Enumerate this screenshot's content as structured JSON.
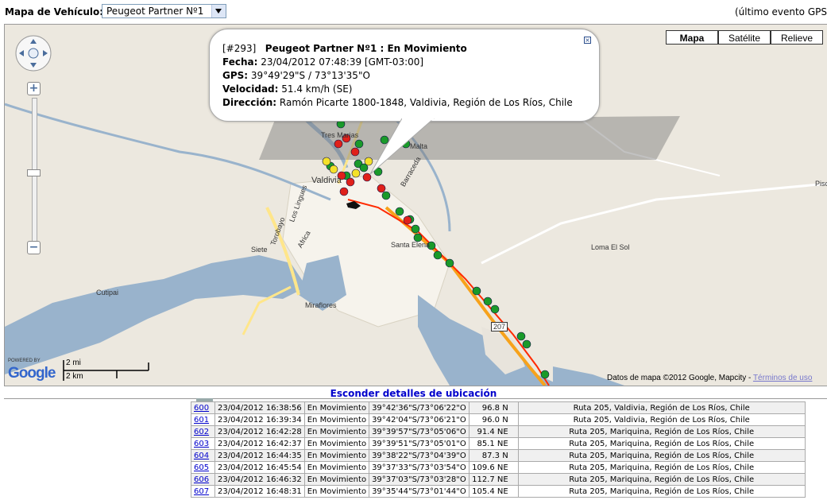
{
  "vehicle_selector": {
    "label": "Mapa de Vehículo:",
    "selected": "Peugeot Partner Nº1"
  },
  "last_event": "(último evento GPS",
  "map_types": [
    {
      "label": "Mapa",
      "active": true
    },
    {
      "label": "Satélite",
      "active": false
    },
    {
      "label": "Relieve",
      "active": false
    }
  ],
  "map_labels": {
    "valdivia": "Valdivia",
    "trumao": "Tres Marias",
    "malta": "Malta",
    "torobayo": "Torobayo",
    "los_lingues": "Los Lingues",
    "africa": "Africa",
    "siete": "Siete",
    "santa_elena": "Santa Elena",
    "cutipai": "Cutipai",
    "miraflores": "Miraflores",
    "loma_el_sol": "Loma El Sol",
    "pisc": "Pisc",
    "barraceda": "Barraceda",
    "route": "207"
  },
  "info_window": {
    "id": "[#293]",
    "vehicle_status": "Peugeot Partner Nº1 : En Movimiento",
    "fecha_label": "Fecha:",
    "fecha": "23/04/2012 07:48:39 [GMT-03:00]",
    "gps_label": "GPS:",
    "gps": "39°49'29\"S / 73°13'35\"O",
    "velocidad_label": "Velocidad:",
    "velocidad": "51.4 km/h  (SE)",
    "direccion_label": "Dirección:",
    "direccion": "Ramón Picarte 1800-1848, Valdivia, Región de Los Ríos, Chile"
  },
  "attribution": {
    "text": "Datos de mapa ©2012 Google, Mapcity - ",
    "terms": "Términos de uso"
  },
  "google": {
    "powered_by": "POWERED BY",
    "logo": "Google"
  },
  "scale": {
    "miles": "2 mi",
    "km": "2 km"
  },
  "details_link": "Esconder detalles de ubicación",
  "log_rows": [
    {
      "num": "600",
      "date": "23/04/2012 16:38:56",
      "status": "En Movimiento",
      "gps": "39°42'36\"S/73°06'22\"O",
      "speed": "96.8 N",
      "address": "Ruta 205, Valdivia, Región de Los Ríos, Chile"
    },
    {
      "num": "601",
      "date": "23/04/2012 16:39:34",
      "status": "En Movimiento",
      "gps": "39°42'04\"S/73°06'21\"O",
      "speed": "96.0 N",
      "address": "Ruta 205, Valdivia, Región de Los Ríos, Chile"
    },
    {
      "num": "602",
      "date": "23/04/2012 16:42:28",
      "status": "En Movimiento",
      "gps": "39°39'57\"S/73°05'06\"O",
      "speed": "91.4 NE",
      "address": "Ruta 205, Mariquina, Región de Los Ríos, Chile"
    },
    {
      "num": "603",
      "date": "23/04/2012 16:42:37",
      "status": "En Movimiento",
      "gps": "39°39'51\"S/73°05'01\"O",
      "speed": "85.1 NE",
      "address": "Ruta 205, Mariquina, Región de Los Ríos, Chile"
    },
    {
      "num": "604",
      "date": "23/04/2012 16:44:35",
      "status": "En Movimiento",
      "gps": "39°38'22\"S/73°04'39\"O",
      "speed": "87.3 N",
      "address": "Ruta 205, Mariquina, Región de Los Ríos, Chile"
    },
    {
      "num": "605",
      "date": "23/04/2012 16:45:54",
      "status": "En Movimiento",
      "gps": "39°37'33\"S/73°03'54\"O",
      "speed": "109.6 NE",
      "address": "Ruta 205, Mariquina, Región de Los Ríos, Chile"
    },
    {
      "num": "606",
      "date": "23/04/2012 16:46:32",
      "status": "En Movimiento",
      "gps": "39°37'03\"S/73°03'28\"O",
      "speed": "112.7 NE",
      "address": "Ruta 205, Mariquina, Región de Los Ríos, Chile"
    },
    {
      "num": "607",
      "date": "23/04/2012 16:48:31",
      "status": "En Movimiento",
      "gps": "39°35'44\"S/73°01'44\"O",
      "speed": "105.4 NE",
      "address": "Ruta 205, Mariquina, Región de Los Ríos, Chile"
    }
  ]
}
